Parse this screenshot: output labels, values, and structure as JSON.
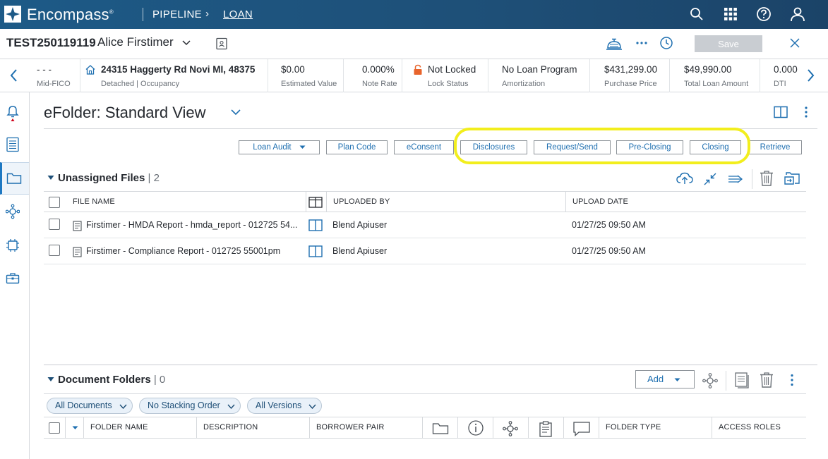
{
  "app": {
    "brand": "Encompass",
    "brand_mark": "®",
    "breadcrumb": [
      "PIPELINE",
      "LOAN"
    ],
    "breadcrumb_sep": "›"
  },
  "loan": {
    "id": "TEST250119119",
    "borrower": "Alice Firstimer",
    "save_label": "Save"
  },
  "info_strip": [
    {
      "value": "- - -",
      "label": "Mid-FICO"
    },
    {
      "value": "24315 Haggerty Rd Novi MI, 48375",
      "label": "Detached | Occupancy"
    },
    {
      "value": "$0.00",
      "label": "Estimated Value"
    },
    {
      "value": "0.000%",
      "label": "Note Rate"
    },
    {
      "value": "Not Locked",
      "label": "Lock Status"
    },
    {
      "value": "No Loan Program",
      "label": "Amortization"
    },
    {
      "value": "$431,299.00",
      "label": "Purchase Price"
    },
    {
      "value": "$49,990.00",
      "label": "Total Loan Amount"
    },
    {
      "value": "0.000",
      "label": "DTI"
    }
  ],
  "efolder": {
    "title": "eFolder: Standard View",
    "actions": [
      "Loan Audit",
      "Plan Code",
      "eConsent",
      "Disclosures",
      "Request/Send",
      "Pre-Closing",
      "Closing",
      "Retrieve"
    ]
  },
  "unassigned": {
    "title": "Unassigned Files",
    "count_text": "| 2",
    "columns": [
      "FILE NAME",
      "UPLOADED BY",
      "UPLOAD DATE"
    ],
    "rows": [
      {
        "file": "Firstimer - HMDA Report - hmda_report - 012725 54...",
        "by": "Blend Apiuser",
        "date": "01/27/25 09:50 AM"
      },
      {
        "file": "Firstimer - Compliance Report - 012725 55001pm",
        "by": "Blend Apiuser",
        "date": "01/27/25 09:50 AM"
      }
    ]
  },
  "folders": {
    "title": "Document Folders",
    "count_text": "| 0",
    "add_label": "Add",
    "filters": [
      "All Documents",
      "No Stacking Order",
      "All Versions"
    ],
    "columns": [
      "FOLDER NAME",
      "DESCRIPTION",
      "BORROWER PAIR",
      "FOLDER TYPE",
      "ACCESS ROLES"
    ]
  },
  "colors": {
    "topbar": "#1d5a87",
    "link_blue": "#1e6fb0",
    "highlight": "#f2ee1d",
    "lock_orange": "#e8642c",
    "alert_red": "#d0021b"
  }
}
